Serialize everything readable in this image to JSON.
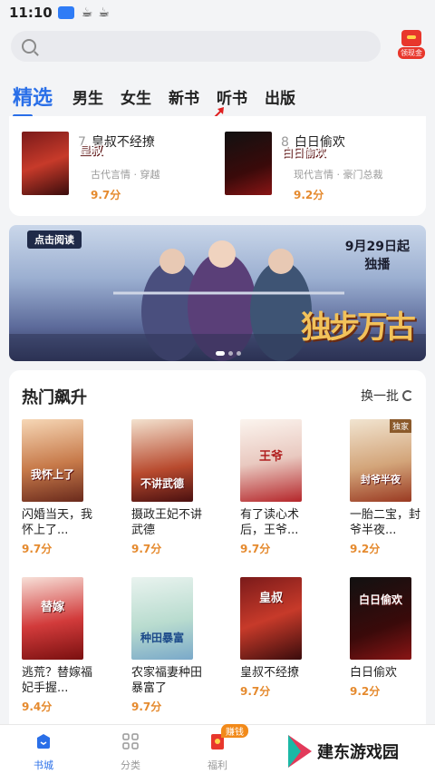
{
  "status_bar": {
    "time": "11:10",
    "badge": "",
    "icon_a": "☕",
    "icon_b": "☕"
  },
  "search": {
    "placeholder": "",
    "reward_label": "领现金"
  },
  "tabs": [
    {
      "label": "精选"
    },
    {
      "label": "男生"
    },
    {
      "label": "女生"
    },
    {
      "label": "新书"
    },
    {
      "label": "听书"
    },
    {
      "label": "出版"
    }
  ],
  "ranking": [
    {
      "rank": "7",
      "title": "皇叔不经撩",
      "tags": "古代言情 · 穿越",
      "score": "9.7分"
    },
    {
      "rank": "8",
      "title": "白日偷欢",
      "tags": "现代言情 · 豪门总裁",
      "score": "9.2分"
    }
  ],
  "banner": {
    "tag": "点击阅读",
    "date_line1": "9月29日起",
    "date_line2": "独播",
    "logo_text": "独步万古"
  },
  "hot": {
    "heading": "热门飙升",
    "refresh_label": "换一批",
    "books": [
      {
        "name": "闪婚当天，我怀上了...",
        "score": "9.7分",
        "cover_text": "我怀上了"
      },
      {
        "name": "摄政王妃不讲武德",
        "score": "9.7分",
        "cover_text": "不讲武德"
      },
      {
        "name": "有了读心术后，王爷...",
        "score": "9.7分",
        "cover_text": "王爷"
      },
      {
        "name": "一胎二宝，封爷半夜...",
        "score": "9.2分",
        "cover_text": "封爷半夜",
        "exclusive": "独家"
      },
      {
        "name": "逃荒？替嫁福妃手握...",
        "score": "9.4分",
        "cover_text": "替嫁"
      },
      {
        "name": "农家福妻种田暴富了",
        "score": "9.7分",
        "cover_text": "种田暴富"
      },
      {
        "name": "皇叔不经撩",
        "score": "9.7分",
        "cover_text": "皇叔"
      },
      {
        "name": "白日偷欢",
        "score": "9.2分",
        "cover_text": "白日偷欢"
      }
    ]
  },
  "bottom_nav": [
    {
      "label": "书城"
    },
    {
      "label": "分类"
    },
    {
      "label": "福利"
    }
  ],
  "earn_badge": "赚钱",
  "watermark": "建东游戏园",
  "colors": {
    "accent": "#2a6fe8",
    "score": "#e58a2e"
  }
}
